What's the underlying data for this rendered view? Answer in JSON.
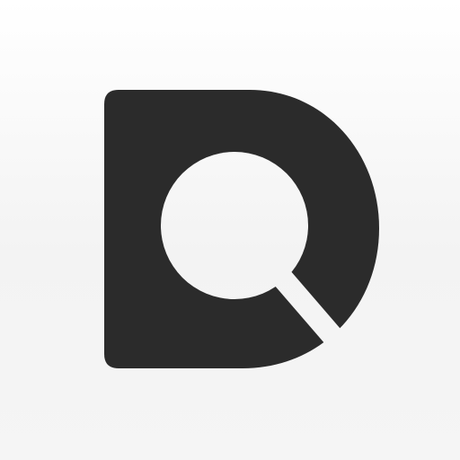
{
  "app_icon": {
    "name": "magnifier-d-logo",
    "colors": {
      "background": "#f4f4f4",
      "glyph": "#2b2b2b"
    }
  }
}
